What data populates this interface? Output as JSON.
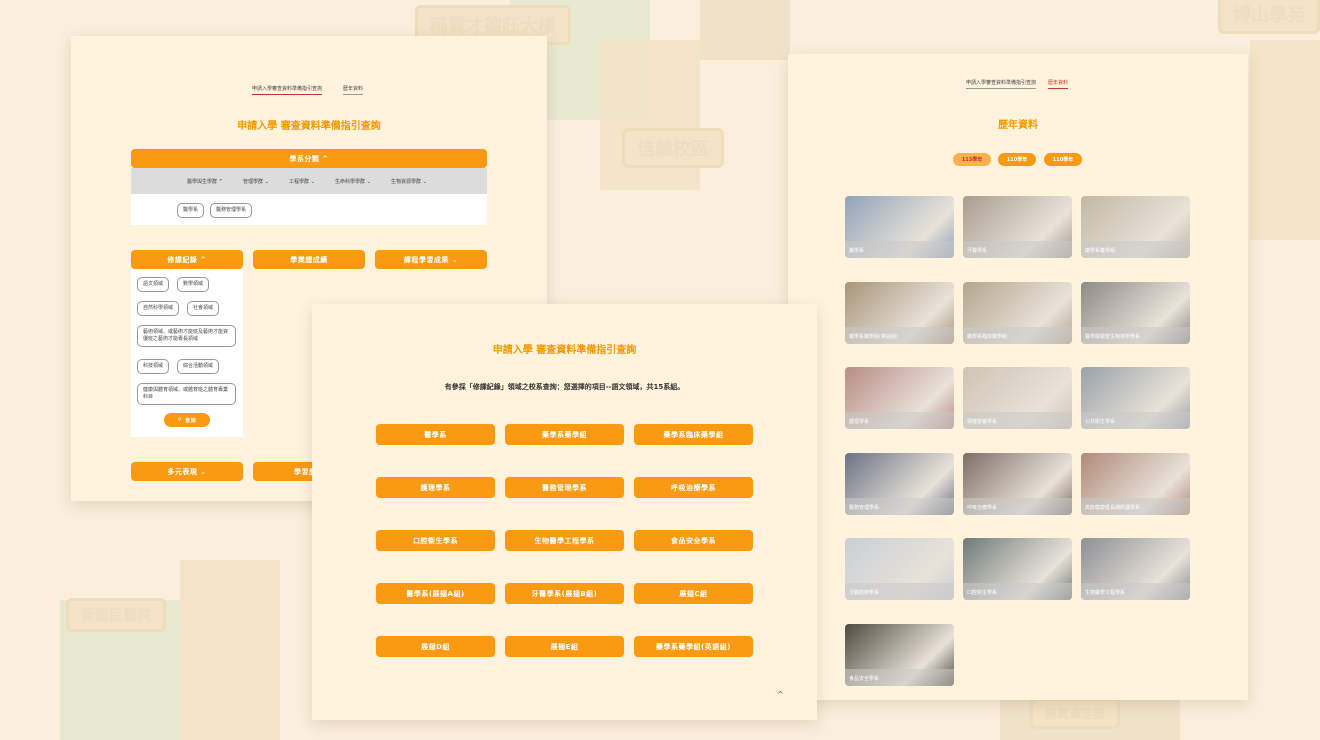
{
  "background": {
    "signs": [
      "稱翼才德旺大樓",
      "信義校區",
      "新國民醫院",
      "博山學苑",
      "稱翼滿足臉"
    ]
  },
  "panel_left": {
    "tabs": [
      {
        "label": "申請入學審查資料準備指引查詢",
        "active": true
      },
      {
        "label": "歷年資料",
        "active": false
      }
    ],
    "title": "申請入學 審查資料準備指引查詢",
    "dept_category_button": "學系分類 ^",
    "college_tabs": [
      "醫學與生學群 ^",
      "管理學群 ⌄",
      "工程學群 ⌄",
      "生命科學學群 ⌄",
      "生物資源學群 ⌄"
    ],
    "dept_chips": [
      "醫學系",
      "醫務管理學系"
    ],
    "section_buttons": {
      "course_record": "修課紀錄 ^",
      "learning_result": "學業總成績",
      "course_learning": "課程學習成果 ⌄",
      "diverse": "多元表現 ⌄",
      "learning_prep": "學習歷程"
    },
    "domain_chips": [
      "語文領域",
      "數學領域",
      "自然科學領域",
      "社會領域",
      "藝術領域、或藝術才能班及藝術才能資優班之藝術才能專長領域",
      "科技領域",
      "綜合活動領域",
      "健康與體育領域、或體育班之體育專業科目"
    ],
    "query_button": "查詢"
  },
  "panel_middle": {
    "title": "申請入學 審查資料準備指引查詢",
    "result_text": "有參採「修課紀錄」領域之校系查詢：您選擇的項目--語文領域，共15系組。",
    "dept_buttons": [
      "醫學系",
      "藥學系藥學組",
      "藥學系臨床藥學組",
      "護理學系",
      "醫務管理學系",
      "呼吸治療學系",
      "口腔衛生學系",
      "生物醫學工程學系",
      "食品安全學系",
      "醫學系(展翅A組)",
      "牙醫學系(展翅B組)",
      "展翅C組",
      "展翅D組",
      "展翅E組",
      "藥學系藥學組(英語組)"
    ],
    "scroll_top_icon": "^"
  },
  "panel_right": {
    "tabs": [
      {
        "label": "申請入學審查資料準備指引查詢",
        "active": false
      },
      {
        "label": "歷年資料",
        "active": true
      }
    ],
    "title": "歷年資料",
    "years": [
      {
        "label": "113學年",
        "active": true
      },
      {
        "label": "110學年",
        "active": false
      },
      {
        "label": "110學年",
        "active": false
      }
    ],
    "cards": [
      {
        "label": "醫學系",
        "color": "#8fa3b8"
      },
      {
        "label": "牙醫學系",
        "color": "#a89c8f"
      },
      {
        "label": "藥學系藥學組",
        "color": "#c2b8a4"
      },
      {
        "label": "藥學系藥學組(英語組)",
        "color": "#a8957a"
      },
      {
        "label": "藥學系臨床藥學組",
        "color": "#b5a58e"
      },
      {
        "label": "醫學檢驗暨生物技術學系",
        "color": "#8d8a84"
      },
      {
        "label": "護理學系",
        "color": "#b88c86"
      },
      {
        "label": "保健營養學系",
        "color": "#cfc4b5"
      },
      {
        "label": "公共衛生學系",
        "color": "#9aa1a8"
      },
      {
        "label": "醫務管理學系",
        "color": "#6b7285"
      },
      {
        "label": "呼吸治療學系",
        "color": "#7e6e66"
      },
      {
        "label": "高齡健康暨長期照護學系",
        "color": "#b08a7a"
      },
      {
        "label": "牙體技術學系",
        "color": "#c9cfd6"
      },
      {
        "label": "口腔衛生學系",
        "color": "#6f7a7a"
      },
      {
        "label": "生物醫學工程學系",
        "color": "#8c8f94"
      },
      {
        "label": "食品安全學系",
        "color": "#4e4a3e"
      }
    ]
  }
}
